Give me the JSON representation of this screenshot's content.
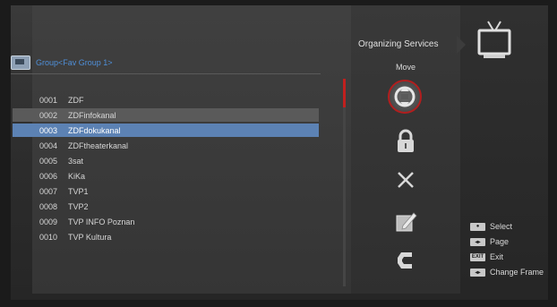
{
  "group": {
    "title": "Group<Fav Group 1>"
  },
  "panel": {
    "title": "Organizing Services",
    "mode_label": "Move"
  },
  "channels": [
    {
      "num": "0001",
      "name": "ZDF"
    },
    {
      "num": "0002",
      "name": "ZDFinfokanal"
    },
    {
      "num": "0003",
      "name": "ZDFdokukanal"
    },
    {
      "num": "0004",
      "name": "ZDFtheaterkanal"
    },
    {
      "num": "0005",
      "name": "3sat"
    },
    {
      "num": "0006",
      "name": "KiKa"
    },
    {
      "num": "0007",
      "name": "TVP1"
    },
    {
      "num": "0008",
      "name": "TVP2"
    },
    {
      "num": "0009",
      "name": "TVP INFO Poznan"
    },
    {
      "num": "0010",
      "name": "TVP Kultura"
    }
  ],
  "actions": [
    {
      "icon": "move-icon"
    },
    {
      "icon": "lock-icon"
    },
    {
      "icon": "delete-icon"
    },
    {
      "icon": "rename-icon"
    },
    {
      "icon": "skip-icon"
    }
  ],
  "help": {
    "select_label": "Select",
    "page_label": "Page",
    "exit_label": "Exit",
    "change_frame_label": "Change Frame",
    "exit_key_text": "EXIT"
  },
  "colors": {
    "accent_blue": "#5c82b4",
    "highlight_grey": "#5a5a5a",
    "accent_red": "#b21e1e",
    "group_title": "#4f8fd8"
  }
}
